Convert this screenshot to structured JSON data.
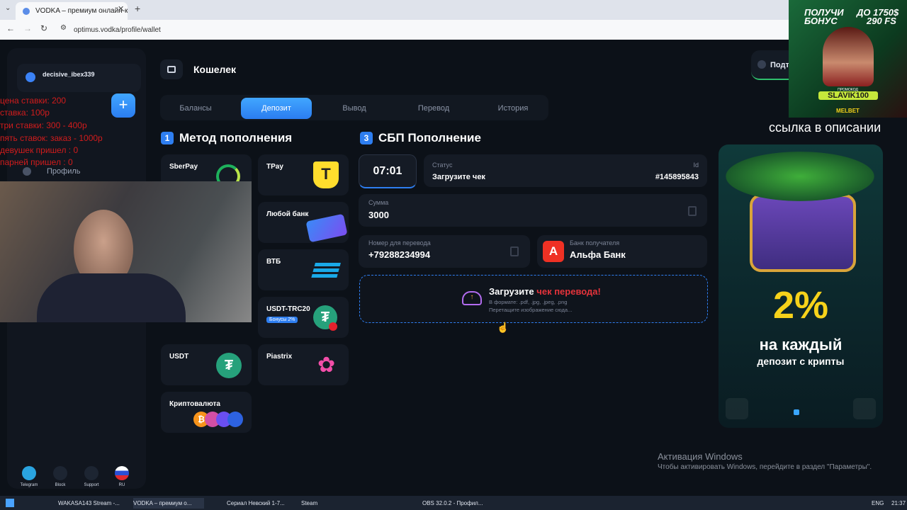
{
  "browser": {
    "tab_title": "VODKA – премиум онлайн-ка",
    "url": "optimus.vodka/profile/wallet"
  },
  "sidebar": {
    "username": "decisive_ibex339",
    "profile_label": "Профиль",
    "bottom_nav": [
      {
        "label": "Telegram",
        "icon": "telegram-icon"
      },
      {
        "label": "Block",
        "icon": "lock-icon"
      },
      {
        "label": "Support",
        "icon": "support-icon"
      },
      {
        "label": "RU",
        "icon": "russia-flag-icon"
      }
    ]
  },
  "header": {
    "title": "Кошелек",
    "right_button": "Подт"
  },
  "tabs": [
    "Балансы",
    "Депозит",
    "Вывод",
    "Перевод",
    "История"
  ],
  "methods_section": {
    "number": "1",
    "title": "Метод пополнения",
    "methods": [
      {
        "label": "SberPay"
      },
      {
        "label": "TPay"
      },
      {
        "label": "Любой банк"
      },
      {
        "label": "ВТБ"
      },
      {
        "label": "USDT-TRC20",
        "badge": "Бонусы 2%"
      },
      {
        "label": "USDT"
      },
      {
        "label": "Piastrix"
      },
      {
        "label": "Криптовалюта"
      }
    ]
  },
  "sbp_section": {
    "number": "3",
    "title": "СБП Пополнение",
    "timer": "07:01",
    "status_label": "Статус",
    "status_value": "Загрузите чек",
    "id_label": "Id",
    "id_value": "#145895843",
    "amount_label": "Сумма",
    "amount_value": "3000",
    "phone_label": "Номер для перевода",
    "phone_value": "+79288234994",
    "bank_label": "Банк получателя",
    "bank_value": "Альфа Банк",
    "upload_title": "Загрузите",
    "upload_title_accent": "чек перевода!",
    "upload_formats": "В формате: .pdf, .jpg, .jpeg, .png",
    "upload_hint": "Перетащите изображение сюда..."
  },
  "promo": {
    "percent": "2%",
    "line1": "на каждый",
    "line2": "депозит с крипты"
  },
  "ad_top": {
    "line1": "ПОЛУЧИ",
    "line2": "БОНУС",
    "line3": "ДО 1750$",
    "line4": "290 FS",
    "promocode_label": "ПРОМОКОД",
    "promocode": "SLAVIK100",
    "brand": "MELBET"
  },
  "stream_overlay": {
    "caption": "ссылка в описании",
    "red_lines": [
      "цена ставки: 200",
      "ставка: 100р",
      "три ставки: 300 - 400р",
      "пять ставок: заказ - 1000р",
      "девушек пришел : 0",
      "парней пришел : 0"
    ]
  },
  "windows": {
    "activation_title": "Активация Windows",
    "activation_text": "Чтобы активировать Windows, перейдите в раздел \"Параметры\".",
    "tasks": [
      "WAKASA143 Stream -...",
      "VODKA – премиум о...",
      "Сериал Невский 1-7...",
      "Steam",
      "OBS 32.0.2 - Профил..."
    ],
    "lang": "ENG",
    "time": "21:37"
  },
  "colors": {
    "accent": "#2e7ef0",
    "background": "#0c1118",
    "card": "#151b25",
    "alfa_red": "#ef3124",
    "upload_accent": "#e5333b",
    "promo_yellow": "#f6d21a"
  }
}
